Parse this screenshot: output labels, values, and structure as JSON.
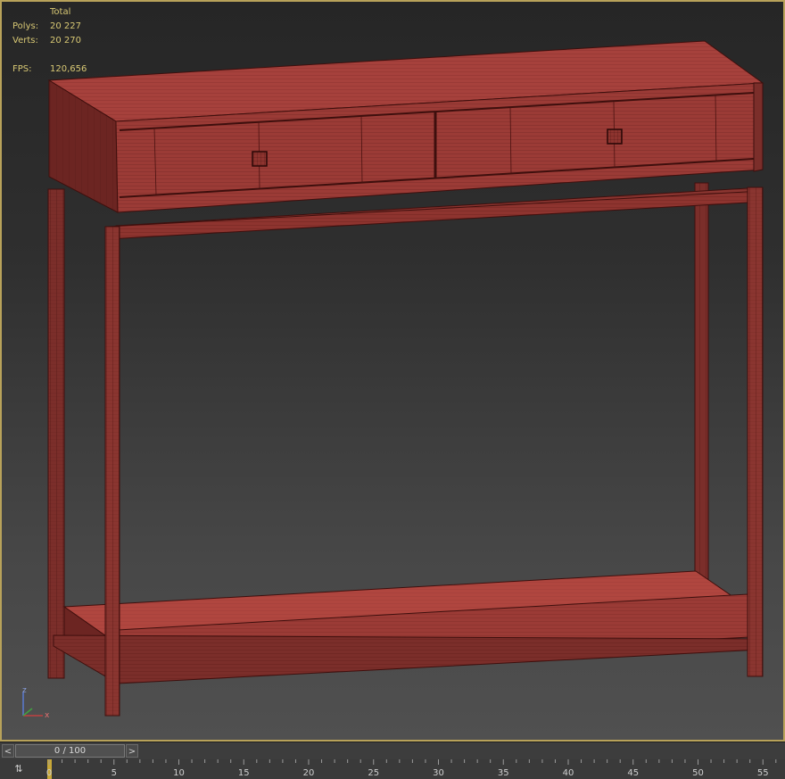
{
  "stats": {
    "header": "Total",
    "polys_label": "Polys:",
    "polys_value": "20 227",
    "verts_label": "Verts:",
    "verts_value": "20 270",
    "fps_label": "FPS:",
    "fps_value": "120,656"
  },
  "axis": {
    "z_label": "z",
    "x_label": "x"
  },
  "timeline": {
    "prev_label": "<",
    "next_label": ">",
    "frame_display": "0 / 100",
    "current_frame_fraction": 0.0
  },
  "ruler": {
    "ticks": [
      "0",
      "5",
      "10",
      "15",
      "20",
      "25",
      "30",
      "35",
      "40",
      "45",
      "50",
      "55"
    ]
  },
  "colors": {
    "furniture": "#a6413c",
    "furniture_dark": "#7b2e2a",
    "wire": "#4a1210",
    "viewport_border": "#b8a25a",
    "stats_text": "#d8c874"
  }
}
